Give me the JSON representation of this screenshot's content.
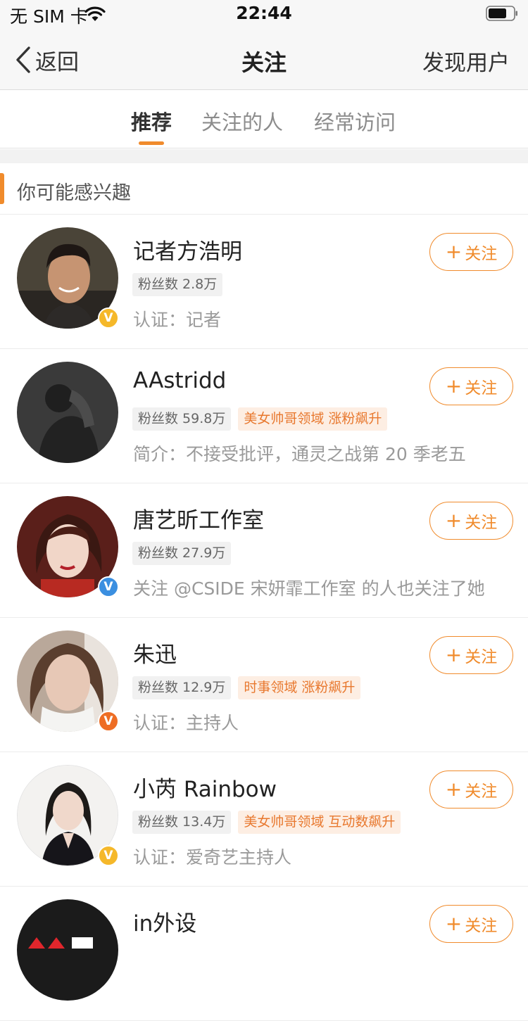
{
  "status_bar": {
    "carrier": "无 SIM 卡",
    "time": "22:44"
  },
  "nav": {
    "back_label": "返回",
    "title": "关注",
    "right_action": "发现用户"
  },
  "tabs": [
    {
      "label": "推荐",
      "active": true
    },
    {
      "label": "关注的人",
      "active": false
    },
    {
      "label": "经常访问",
      "active": false
    }
  ],
  "section": {
    "title": "你可能感兴趣"
  },
  "colors": {
    "accent": "#f08b2c",
    "badge_yellow": "#f5b82a",
    "badge_blue": "#3b8fe0",
    "badge_orange": "#ee6d24"
  },
  "follow_label": "关注",
  "users": [
    {
      "name": "记者方浩明",
      "fans": "粉丝数 2.8万",
      "tags": [],
      "desc": "认证：记者",
      "badge": "V",
      "badge_color": "#f5b82a",
      "avatar_icon": "person-portrait"
    },
    {
      "name": "AAstridd",
      "fans": "粉丝数 59.8万",
      "tags": [
        "美女帅哥领域 涨粉飙升"
      ],
      "desc": "简介：不接受批评，通灵之战第 20 季老五",
      "badge": "",
      "badge_color": "",
      "avatar_icon": "person-portrait"
    },
    {
      "name": "唐艺昕工作室",
      "fans": "粉丝数 27.9万",
      "tags": [],
      "desc": "关注 @CSIDE 宋妍霏工作室 的人也关注了她",
      "badge": "V",
      "badge_color": "#3b8fe0",
      "avatar_icon": "person-portrait"
    },
    {
      "name": "朱迅",
      "fans": "粉丝数 12.9万",
      "tags": [
        "时事领域 涨粉飙升"
      ],
      "desc": "认证：主持人",
      "badge": "V",
      "badge_color": "#ee6d24",
      "avatar_icon": "person-portrait"
    },
    {
      "name": "小芮 Rainbow",
      "fans": "粉丝数 13.4万",
      "tags": [
        "美女帅哥领域 互动数飙升"
      ],
      "desc": "认证：爱奇艺主持人",
      "badge": "V",
      "badge_color": "#f5b82a",
      "avatar_icon": "person-portrait"
    },
    {
      "name": "in外设",
      "fans": "",
      "tags": [],
      "desc": "",
      "badge": "",
      "badge_color": "",
      "avatar_icon": "logo"
    }
  ]
}
